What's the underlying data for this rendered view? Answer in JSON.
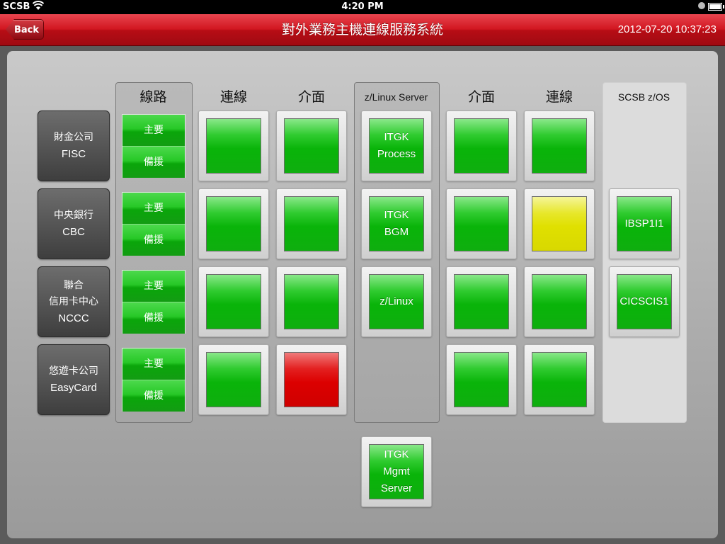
{
  "status_bar": {
    "carrier": "SCSB",
    "time": "4:20 PM"
  },
  "nav": {
    "back_label": "Back",
    "title": "對外業務主機連線服務系統",
    "datetime": "2012-07-20 10:37:23"
  },
  "columns": {
    "route": "線路",
    "connection_left": "連線",
    "interface_left": "介面",
    "linux_server": "z/Linux Server",
    "interface_right": "介面",
    "connection_right": "連線",
    "zos": "SCSB z/OS"
  },
  "partners": [
    {
      "line1": "財金公司",
      "line2": "FISC",
      "line3": ""
    },
    {
      "line1": "中央銀行",
      "line2": "CBC",
      "line3": ""
    },
    {
      "line1": "聯合",
      "line2": "信用卡中心",
      "line3": "NCCC"
    },
    {
      "line1": "悠遊卡公司",
      "line2": "EasyCard",
      "line3": ""
    }
  ],
  "routes": {
    "primary": "主要",
    "backup": "備援"
  },
  "servers": [
    {
      "line1": "ITGK",
      "line2": "Process",
      "line3": ""
    },
    {
      "line1": "ITGK",
      "line2": "BGM",
      "line3": ""
    },
    {
      "line1": "z/Linux",
      "line2": "",
      "line3": ""
    }
  ],
  "mgmt_server": {
    "line1": "ITGK",
    "line2": "Mgmt",
    "line3": "Server"
  },
  "zos_systems": [
    "IBSP1I1",
    "CICSCIS1"
  ],
  "status_grid": {
    "connection_left": [
      "green",
      "green",
      "green",
      "green"
    ],
    "interface_left": [
      "green",
      "green",
      "green",
      "red"
    ],
    "interface_right": [
      "green",
      "green",
      "green",
      "green"
    ],
    "connection_right": [
      "green",
      "yellow",
      "green",
      "green"
    ]
  },
  "colors": {
    "green": "#09b409",
    "yellow": "#e0e000",
    "red": "#dc0000",
    "nav_red": "#d11620"
  }
}
